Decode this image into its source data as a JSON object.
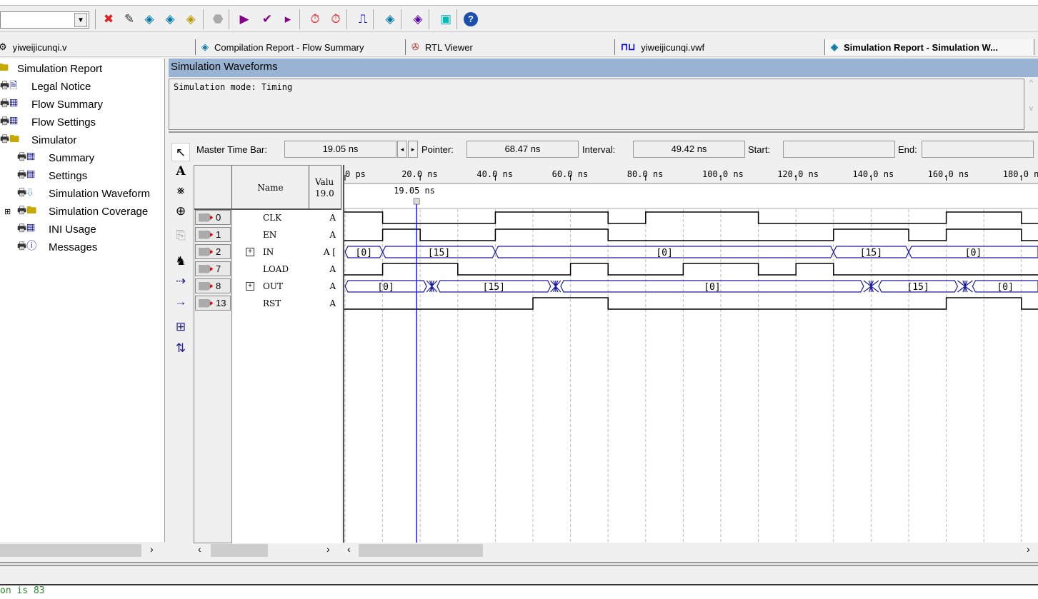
{
  "toolbar": {
    "icons": [
      "compile-icon",
      "pencil-icon",
      "analysis-icon",
      "fitter-icon",
      "assembler-icon",
      "stop-icon",
      "start-icon",
      "check-icon",
      "timing-icon",
      "timer-icon",
      "timer2-icon",
      "simulate-icon",
      "report-icon",
      "programmer-icon",
      "chip-icon",
      "help-icon"
    ]
  },
  "tabs": [
    {
      "label": "yiweijicunqi.v",
      "icon": "verilog-file-icon"
    },
    {
      "label": "Compilation Report - Flow Summary",
      "icon": "report-icon"
    },
    {
      "label": "RTL Viewer",
      "icon": "rtl-viewer-icon"
    },
    {
      "label": "yiweijicunqi.vwf",
      "icon": "waveform-file-icon"
    },
    {
      "label": "Simulation Report - Simulation W...",
      "icon": "report-icon",
      "active": true
    }
  ],
  "tree": [
    {
      "label": "Simulation Report",
      "icon": "folder-icon",
      "level": 0
    },
    {
      "label": "Legal Notice",
      "icon": "document-icon",
      "level": 0
    },
    {
      "label": "Flow Summary",
      "icon": "table-icon",
      "level": 0
    },
    {
      "label": "Flow Settings",
      "icon": "table-icon",
      "level": 0
    },
    {
      "label": "Simulator",
      "icon": "folder-icon",
      "level": 0
    },
    {
      "label": "Summary",
      "icon": "table-icon",
      "level": 1
    },
    {
      "label": "Settings",
      "icon": "table-icon",
      "level": 1
    },
    {
      "label": "Simulation Waveform",
      "icon": "waveform-icon",
      "level": 1
    },
    {
      "label": "Simulation Coverage",
      "icon": "folder-icon",
      "level": 1,
      "expandable": true
    },
    {
      "label": "INI Usage",
      "icon": "table-icon",
      "level": 1
    },
    {
      "label": "Messages",
      "icon": "info-icon",
      "level": 1
    }
  ],
  "report": {
    "title": "Simulation Waveforms",
    "body": "Simulation mode: Timing"
  },
  "timebar": {
    "master_label": "Master Time Bar:",
    "master_value": "19.05 ns",
    "pointer_label": "Pointer:",
    "pointer_value": "68.47 ns",
    "interval_label": "Interval:",
    "interval_value": "49.42 ns",
    "start_label": "Start:",
    "start_value": "",
    "end_label": "End:",
    "end_value": ""
  },
  "grid": {
    "name_header": "Name",
    "value_header": "Valu",
    "value_sub": "19.0",
    "marker_label": "19.05 ns"
  },
  "chart_data": {
    "type": "timing",
    "time_unit": "ns",
    "xlim": [
      0,
      185
    ],
    "ticks": [
      {
        "t": 0,
        "label": "0 ps"
      },
      {
        "t": 20,
        "label": "20.0 ns"
      },
      {
        "t": 40,
        "label": "40.0 ns"
      },
      {
        "t": 60,
        "label": "60.0 ns"
      },
      {
        "t": 80,
        "label": "80.0 ns"
      },
      {
        "t": 100,
        "label": "100.0 ns"
      },
      {
        "t": 120,
        "label": "120.0 ns"
      },
      {
        "t": 140,
        "label": "140.0 ns"
      },
      {
        "t": 160,
        "label": "160.0 ns"
      },
      {
        "t": 180,
        "label": "180.0 ns"
      }
    ],
    "grid_step": 10,
    "master_time": 19.05,
    "signals": [
      {
        "index": "0",
        "name": "CLK",
        "value": "A",
        "kind": "bit",
        "initial": 1,
        "edges": [
          10,
          40,
          70,
          80,
          110,
          160,
          180
        ]
      },
      {
        "index": "1",
        "name": "EN",
        "value": "A",
        "kind": "bit",
        "initial": 0,
        "edges": [
          10,
          20,
          40,
          70,
          130,
          150,
          160,
          180
        ]
      },
      {
        "index": "2",
        "name": "IN",
        "value": "A [",
        "kind": "bus",
        "expand": true,
        "segments": [
          {
            "from": 0,
            "to": 10,
            "value": "[0]"
          },
          {
            "from": 10,
            "to": 40,
            "value": "[15]"
          },
          {
            "from": 40,
            "to": 130,
            "value": "[0]"
          },
          {
            "from": 130,
            "to": 150,
            "value": "[15]"
          },
          {
            "from": 150,
            "to": 185,
            "value": "[0]"
          }
        ]
      },
      {
        "index": "7",
        "name": "LOAD",
        "value": "A",
        "kind": "bit",
        "initial": 0,
        "edges": [
          10,
          30,
          60,
          70,
          90,
          110,
          120,
          130
        ]
      },
      {
        "index": "8",
        "name": "OUT",
        "value": "A",
        "kind": "bus",
        "expand": true,
        "segments": [
          {
            "from": 0,
            "to": 21.7,
            "value": "[0]"
          },
          {
            "from": 21.7,
            "to": 24.5,
            "glitch": true
          },
          {
            "from": 24.5,
            "to": 54.7,
            "value": "[15]"
          },
          {
            "from": 54.7,
            "to": 57.4,
            "glitch": true
          },
          {
            "from": 57.4,
            "to": 138,
            "value": "[0]"
          },
          {
            "from": 138,
            "to": 142,
            "glitch": true
          },
          {
            "from": 142,
            "to": 163,
            "value": "[15]"
          },
          {
            "from": 163,
            "to": 167,
            "glitch": true
          },
          {
            "from": 167,
            "to": 185,
            "value": "[0]"
          }
        ]
      },
      {
        "index": "13",
        "name": "RST",
        "value": "A",
        "kind": "bit",
        "initial": 0,
        "edges": [
          50,
          70,
          160,
          180
        ]
      }
    ]
  },
  "status": {
    "message": "on is 83"
  }
}
